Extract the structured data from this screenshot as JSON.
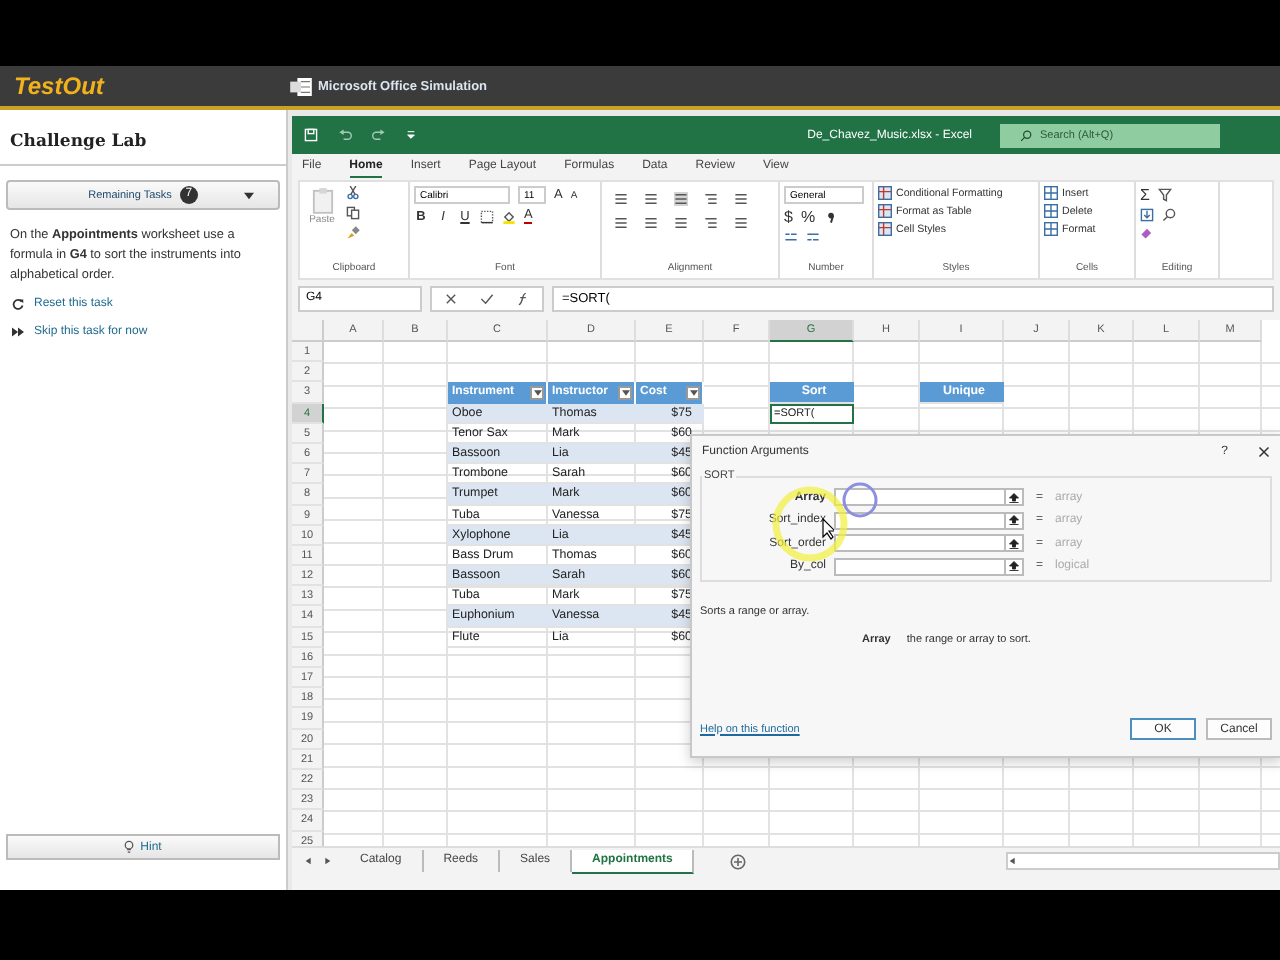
{
  "header": {
    "logo": "TestOut",
    "title": "Microsoft Office Simulation"
  },
  "sidebar": {
    "title": "Challenge Lab",
    "tasks_button": {
      "label": "Remaining Tasks",
      "count": "7"
    },
    "instructions": "On the **Appointments** worksheet use a formula in **G4** to sort the instruments into alphabetical order.",
    "links": [
      "Reset this task",
      "Skip this task for now"
    ],
    "hint": "Hint"
  },
  "excel": {
    "title": "De_Chavez_Music.xlsx - Excel",
    "search": {
      "placeholder": "Search (Alt+Q)"
    },
    "ribbon_tabs": [
      {
        "label": "File",
        "selected": false
      },
      {
        "label": "Home",
        "selected": true
      },
      {
        "label": "Insert",
        "selected": false
      },
      {
        "label": "Page Layout",
        "selected": false
      },
      {
        "label": "Formulas",
        "selected": false
      },
      {
        "label": "Data",
        "selected": false
      },
      {
        "label": "Review",
        "selected": false
      },
      {
        "label": "View",
        "selected": false
      }
    ],
    "ribbon": {
      "groups": [
        "Clipboard",
        "Font",
        "Alignment",
        "Number",
        "Styles",
        "Cells",
        "Editing"
      ],
      "paste": "Paste",
      "font_name": "Calibri",
      "font_size": "11",
      "size_buttons": [
        "A",
        "A"
      ],
      "font_styles": [
        "B",
        "I",
        "U"
      ],
      "font_color": "A",
      "number_format": "General",
      "number_symbols": [
        "$",
        "%"
      ],
      "styles": [
        "Conditional Formatting",
        "Format as Table",
        "Cell Styles"
      ],
      "cells": [
        "Insert",
        "Delete",
        "Format"
      ],
      "sum": "Σ"
    },
    "name_box": "G4",
    "formula": "=SORT(",
    "columns": [
      {
        "label": "A",
        "selected": false
      },
      {
        "label": "B",
        "selected": false
      },
      {
        "label": "C",
        "selected": false
      },
      {
        "label": "D",
        "selected": false
      },
      {
        "label": "E",
        "selected": false
      },
      {
        "label": "F",
        "selected": false
      },
      {
        "label": "G",
        "selected": true
      },
      {
        "label": "H",
        "selected": false
      },
      {
        "label": "I",
        "selected": false
      },
      {
        "label": "J",
        "selected": false
      },
      {
        "label": "K",
        "selected": false
      },
      {
        "label": "L",
        "selected": false
      },
      {
        "label": "M",
        "selected": false
      }
    ],
    "rows": [
      {
        "label": "1",
        "selected": false
      },
      {
        "label": "2",
        "selected": false
      },
      {
        "label": "3",
        "selected": false
      },
      {
        "label": "4",
        "selected": true
      },
      {
        "label": "5",
        "selected": false
      },
      {
        "label": "6",
        "selected": false
      },
      {
        "label": "7",
        "selected": false
      },
      {
        "label": "8",
        "selected": false
      },
      {
        "label": "9",
        "selected": false
      },
      {
        "label": "10",
        "selected": false
      },
      {
        "label": "11",
        "selected": false
      },
      {
        "label": "12",
        "selected": false
      },
      {
        "label": "13",
        "selected": false
      },
      {
        "label": "14",
        "selected": false
      },
      {
        "label": "15",
        "selected": false
      },
      {
        "label": "16",
        "selected": false
      },
      {
        "label": "17",
        "selected": false
      },
      {
        "label": "18",
        "selected": false
      },
      {
        "label": "19",
        "selected": false
      },
      {
        "label": "20",
        "selected": false
      },
      {
        "label": "21",
        "selected": false
      },
      {
        "label": "22",
        "selected": false
      },
      {
        "label": "23",
        "selected": false
      },
      {
        "label": "24",
        "selected": false
      },
      {
        "label": "25",
        "selected": false
      }
    ],
    "table": {
      "columns": [
        "Instrument",
        "Instructor",
        "Cost"
      ],
      "rows": [
        [
          "Oboe",
          "Thomas",
          "$75"
        ],
        [
          "Tenor Sax",
          "Mark",
          "$60"
        ],
        [
          "Bassoon",
          "Lia",
          "$45"
        ],
        [
          "Trombone",
          "Sarah",
          "$60"
        ],
        [
          "Trumpet",
          "Mark",
          "$60"
        ],
        [
          "Tuba",
          "Vanessa",
          "$75"
        ],
        [
          "Xylophone",
          "Lia",
          "$45"
        ],
        [
          "Bass Drum",
          "Thomas",
          "$60"
        ],
        [
          "Bassoon",
          "Sarah",
          "$60"
        ],
        [
          "Tuba",
          "Mark",
          "$75"
        ],
        [
          "Euphonium",
          "Vanessa",
          "$45"
        ],
        [
          "Flute",
          "Lia",
          "$60"
        ]
      ]
    },
    "output_headers": [
      "Sort",
      "Unique"
    ],
    "active_cell": "=SORT(",
    "sheet_tabs": [
      {
        "label": "Catalog",
        "selected": false
      },
      {
        "label": "Reeds",
        "selected": false
      },
      {
        "label": "Sales",
        "selected": false
      },
      {
        "label": "Appointments",
        "selected": true
      }
    ],
    "dialog": {
      "title": "Function Arguments",
      "help": "?",
      "function": "SORT",
      "arguments": [
        {
          "name": "Array",
          "required": true,
          "equals": "=",
          "hint": "array"
        },
        {
          "name": "Sort_index",
          "required": false,
          "equals": "=",
          "hint": "array"
        },
        {
          "name": "Sort_order",
          "required": false,
          "equals": "=",
          "hint": "array"
        },
        {
          "name": "By_col",
          "required": false,
          "equals": "=",
          "hint": "logical"
        }
      ],
      "description": "Sorts a range or array.",
      "argument_name": "Array",
      "argument_description": "the range or array to sort.",
      "help_link": "Help on this function",
      "buttons": [
        "OK",
        "Cancel"
      ]
    }
  }
}
